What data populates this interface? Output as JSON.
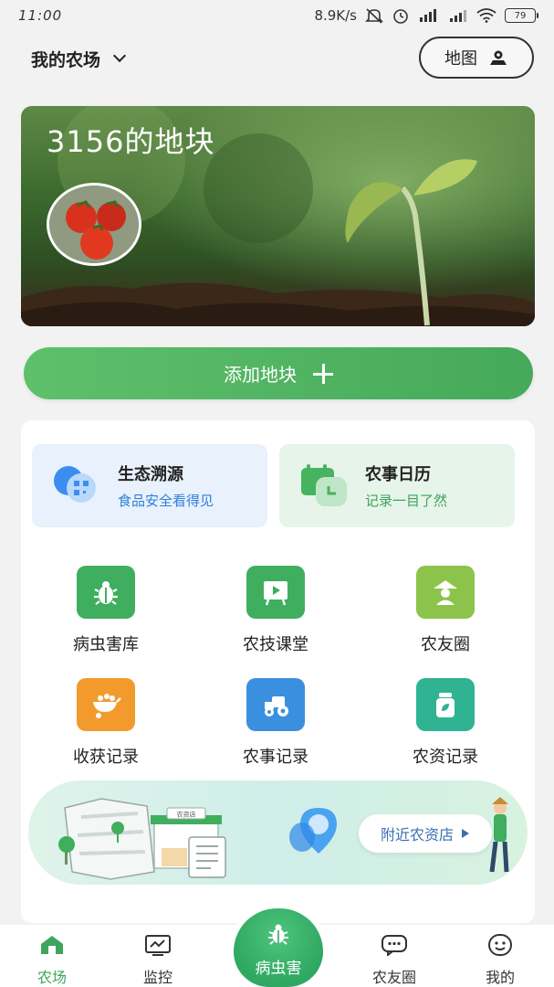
{
  "status_bar": {
    "time": "11:00",
    "network_speed": "8.9K/s",
    "battery": "79"
  },
  "header": {
    "farm_name": "我的农场",
    "map_label": "地图"
  },
  "banner": {
    "title": "3156的地块"
  },
  "add_plot_label": "添加地块",
  "features": [
    {
      "title": "生态溯源",
      "subtitle": "食品安全看得见",
      "icon": "qr-trace-icon"
    },
    {
      "title": "农事日历",
      "subtitle": "记录一目了然",
      "icon": "calendar-icon"
    }
  ],
  "grid": [
    {
      "label": "病虫害库",
      "icon": "bug-icon",
      "color": "#3fae5e"
    },
    {
      "label": "农技课堂",
      "icon": "video-board-icon",
      "color": "#3fae5e"
    },
    {
      "label": "农友圈",
      "icon": "farmer-icon",
      "color": "#8cc34a"
    },
    {
      "label": "收获记录",
      "icon": "harvest-cart-icon",
      "color": "#f39a2c"
    },
    {
      "label": "农事记录",
      "icon": "tractor-icon",
      "color": "#3b8fdf"
    },
    {
      "label": "农资记录",
      "icon": "jar-icon",
      "color": "#2fb392"
    }
  ],
  "store_banner": {
    "sign_label": "农资店",
    "button_label": "附近农资店"
  },
  "bottom_nav": {
    "items": [
      {
        "label": "农场",
        "icon": "home-icon",
        "active": true
      },
      {
        "label": "监控",
        "icon": "monitor-icon",
        "active": false
      },
      {
        "label": "病虫害",
        "icon": "bug-icon",
        "active": false
      },
      {
        "label": "农友圈",
        "icon": "chat-icon",
        "active": false
      },
      {
        "label": "我的",
        "icon": "smile-icon",
        "active": false
      }
    ]
  },
  "colors": {
    "primary_green": "#4cb464",
    "trace_blue": "#2f7fd8",
    "calendar_green": "#3aa35a"
  }
}
